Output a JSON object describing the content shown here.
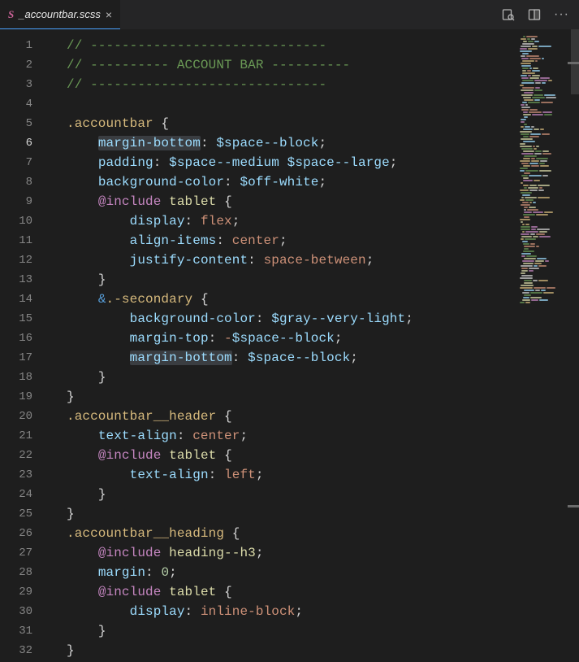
{
  "tab": {
    "filename": "_accountbar.scss",
    "close": "×"
  },
  "actions": {
    "ellipsis": "···"
  },
  "gutter": {
    "current": 6,
    "lines": [
      1,
      2,
      3,
      4,
      5,
      6,
      7,
      8,
      9,
      10,
      11,
      12,
      13,
      14,
      15,
      16,
      17,
      18,
      19,
      20,
      21,
      22,
      23,
      24,
      25,
      26,
      27,
      28,
      29,
      30,
      31,
      32
    ]
  },
  "code": {
    "comment_dash": "// ------------------------------",
    "comment_mid": "// ---------- ACCOUNT BAR ----------",
    "sel_accountbar": ".accountbar",
    "sel_header": ".accountbar__header",
    "sel_heading": ".accountbar__heading",
    "amp": "&",
    "secondary": ".-secondary",
    "include": "@include",
    "mx_tablet": "tablet",
    "mx_h3": "heading--h3",
    "p_margin_bottom": "margin-bottom",
    "p_padding": "padding",
    "p_bgcolor": "background-color",
    "p_display": "display",
    "p_align_items": "align-items",
    "p_justify": "justify-content",
    "p_margin_top": "margin-top",
    "p_text_align": "text-align",
    "p_margin": "margin",
    "v_space_block": "$space--block",
    "v_space_medium": "$space--medium",
    "v_space_large": "$space--large",
    "v_off_white": "$off-white",
    "v_flex": "flex",
    "v_center": "center",
    "v_space_between": "space-between",
    "v_gray_vl": "$gray--very-light",
    "v_neg_space_block": "-$space--block",
    "v_left": "left",
    "v_inline_block": "inline-block",
    "v_zero": "0",
    "colon": ":",
    "semi": ";",
    "lbrace": "{",
    "rbrace": "}",
    "space": " "
  }
}
